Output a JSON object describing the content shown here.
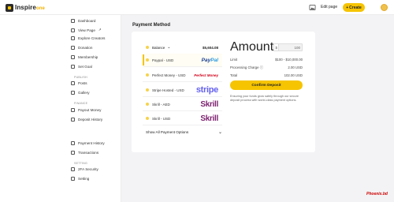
{
  "brand": {
    "name": "Inspire",
    "suffix": "one"
  },
  "topbar": {
    "edit_page": "Edit page",
    "create": "Create",
    "create_plus": "+"
  },
  "sidebar": {
    "items_top": [
      "Dashboard",
      "View Page",
      "Explore Creators",
      "Donation",
      "Membership",
      "Set Goal"
    ],
    "view_page_mark": "↗",
    "section_publish": "PUBLISH",
    "items_publish": [
      "Posts",
      "Gallery"
    ],
    "section_finance": "FINANCE",
    "items_finance": [
      "Payout Money",
      "Deposit History"
    ],
    "items_bottom": [
      "Payment History",
      "Transactions"
    ],
    "section_setting": "SETTING",
    "items_setting": [
      "2FA Security",
      "Setting"
    ]
  },
  "page": {
    "title": "Payment Method"
  },
  "methods": {
    "balance": {
      "label": "Balance",
      "chevron": "⌄",
      "value": "$5,604.08"
    },
    "rows": [
      {
        "label": "Paypal - USD",
        "brand": "PayPal",
        "selected": true
      },
      {
        "label": "Perfect Money - USD",
        "brand": "Perfect Money"
      },
      {
        "label": "Stripe Hosted - USD",
        "brand": "stripe"
      },
      {
        "label": "Skrill - AED",
        "brand": "Skrill"
      },
      {
        "label": "Skrill - USD",
        "brand": "Skrill"
      }
    ],
    "show_all": "Show All Payment Options",
    "show_all_chevron": "⌄"
  },
  "summary": {
    "amount_label": "Amount",
    "currency_symbol": "$",
    "amount_value": "100",
    "limit_label": "Limit",
    "limit_value": "$100 - $10,000.00",
    "charge_label": "Processing Charge",
    "charge_info": "ⓘ",
    "charge_value": "2.00 USD",
    "total_label": "Total",
    "total_value": "102.00 USD",
    "confirm": "Confirm Deposit",
    "notice": "Ensuring your funds grow safely through our secure deposit process with world-class payment options."
  },
  "watermark": "Phoenix.bd"
}
